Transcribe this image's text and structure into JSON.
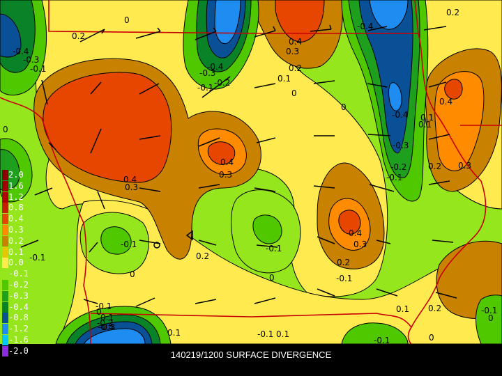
{
  "caption": "140219/1200 SURFACE DIVERGENCE",
  "legend": [
    {
      "label": "2.0",
      "color": "#8B0000"
    },
    {
      "label": "1.6",
      "color": "#A00000"
    },
    {
      "label": "1.2",
      "color": "#B00000"
    },
    {
      "label": "0.8",
      "color": "#C81E00"
    },
    {
      "label": "0.4",
      "color": "#E64600"
    },
    {
      "label": "0.3",
      "color": "#FF8C00"
    },
    {
      "label": "0.2",
      "color": "#C88200"
    },
    {
      "label": "0.1",
      "color": "#E6C800"
    },
    {
      "label": "0.0",
      "color": "#FFEB50"
    },
    {
      "label": "-0.1",
      "color": "#96E61E"
    },
    {
      "label": "-0.2",
      "color": "#50C800"
    },
    {
      "label": "-0.3",
      "color": "#1EA01E"
    },
    {
      "label": "-0.4",
      "color": "#0A8228"
    },
    {
      "label": "-0.8",
      "color": "#0A5096"
    },
    {
      "label": "-1.2",
      "color": "#1E8CF0"
    },
    {
      "label": "-1.6",
      "color": "#00C8FF"
    },
    {
      "label": "-2.0",
      "color": "#8A2BE2"
    }
  ],
  "map_labels": [
    "0.2",
    "0",
    "-0.4",
    "-0.3",
    "-0.1",
    "-0.3",
    "-0.4",
    "-0.1",
    "-0.2",
    "0.4",
    "0.3",
    "0.2",
    "0.1",
    "0",
    "-0.4",
    "0.4",
    "0",
    "-0.4",
    "-0.3",
    "0.4",
    "0.3",
    "-0.2",
    "-0.1",
    "0.2",
    "0.3",
    "0.4",
    "0.3",
    "-0.1",
    "0",
    "0.2",
    "-0.1",
    "0.4",
    "0.3",
    "0.2",
    "-0.1",
    "0",
    "-0.1",
    "0",
    "0.1",
    "-0.2",
    "-0.3",
    "-0.4",
    "0.1",
    "-0.1",
    "0.1",
    "0.2",
    "-0.1",
    "0.1",
    "0",
    "-0.1",
    "0.2",
    "-0.1",
    "0.1",
    "0",
    "0",
    "0.1"
  ]
}
